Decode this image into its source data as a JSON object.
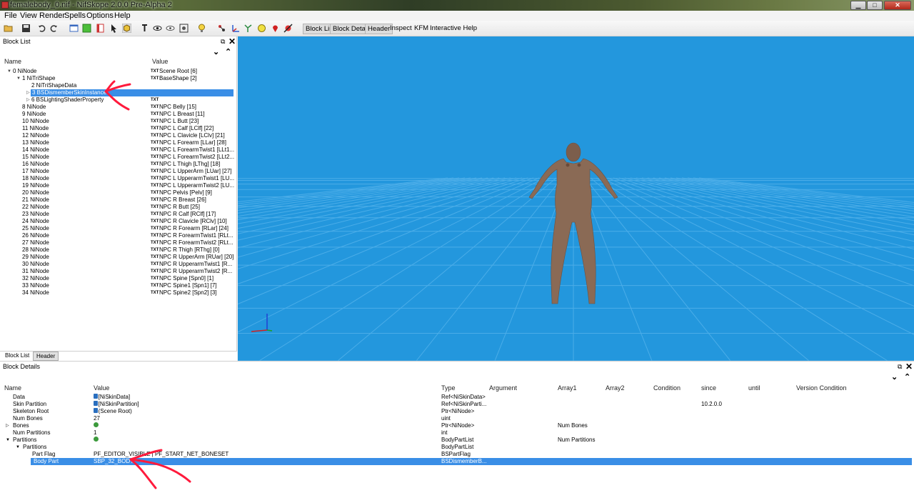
{
  "window": {
    "title": "femalebody_0.nif - NifSkope 2.0.0 Pre-Alpha 2",
    "minimize": "▁",
    "maximize": "□",
    "close": "✕"
  },
  "menu": [
    "File",
    "View",
    "Render",
    "Spells",
    "Options",
    "Help"
  ],
  "toolbar": {
    "buttons": [
      "Block List",
      "Block Details",
      "Header",
      "Inspect",
      "KFM",
      "Interactive Help"
    ]
  },
  "block_list": {
    "title": "Block List",
    "float_icon": "⧉",
    "close_icon": "✕",
    "expand_all": "⌄",
    "collapse_all": "⌃",
    "col_name": "Name",
    "col_value": "Value",
    "txt_icon": "TXT",
    "rows": [
      {
        "name": "0 NiNode",
        "value": "Scene Root [6]"
      },
      {
        "name": "1 NiTriShape",
        "value": "BaseShape [2]"
      },
      {
        "name": "2 NiTriShapeData",
        "value": ""
      },
      {
        "name": "3 BSDismemberSkinInstance",
        "value": ""
      },
      {
        "name": "6 BSLightingShaderProperty",
        "value": ""
      },
      {
        "name": "8 NiNode",
        "value": "NPC Belly [15]"
      },
      {
        "name": "9 NiNode",
        "value": "NPC L Breast [11]"
      },
      {
        "name": "10 NiNode",
        "value": "NPC L Butt [23]"
      },
      {
        "name": "11 NiNode",
        "value": "NPC L Calf [LClf] [22]"
      },
      {
        "name": "12 NiNode",
        "value": "NPC L Clavicle [LClv] [21]"
      },
      {
        "name": "13 NiNode",
        "value": "NPC L Forearm [LLar] [28]"
      },
      {
        "name": "14 NiNode",
        "value": "NPC L ForearmTwist1 [LLt1..."
      },
      {
        "name": "15 NiNode",
        "value": "NPC L ForearmTwist2 [LLt2..."
      },
      {
        "name": "16 NiNode",
        "value": "NPC L Thigh [LThg] [18]"
      },
      {
        "name": "17 NiNode",
        "value": "NPC L UpperArm [LUar] [27]"
      },
      {
        "name": "18 NiNode",
        "value": "NPC L UpperarmTwist1 [LU..."
      },
      {
        "name": "19 NiNode",
        "value": "NPC L UpperarmTwist2 [LU..."
      },
      {
        "name": "20 NiNode",
        "value": "NPC Pelvis [Pelv] [9]"
      },
      {
        "name": "21 NiNode",
        "value": "NPC R Breast [26]"
      },
      {
        "name": "22 NiNode",
        "value": "NPC R Butt [25]"
      },
      {
        "name": "23 NiNode",
        "value": "NPC R Calf [RClf] [17]"
      },
      {
        "name": "24 NiNode",
        "value": "NPC R Clavicle [RClv] [10]"
      },
      {
        "name": "25 NiNode",
        "value": "NPC R Forearm [RLar] [24]"
      },
      {
        "name": "26 NiNode",
        "value": "NPC R ForearmTwist1 [RLt..."
      },
      {
        "name": "27 NiNode",
        "value": "NPC R ForearmTwist2 [RLt..."
      },
      {
        "name": "28 NiNode",
        "value": "NPC R Thigh [RThg] [0]"
      },
      {
        "name": "29 NiNode",
        "value": "NPC R UpperArm [RUar] [20]"
      },
      {
        "name": "30 NiNode",
        "value": "NPC R UpperarmTwist1 [R..."
      },
      {
        "name": "31 NiNode",
        "value": "NPC R UpperarmTwist2 [R..."
      },
      {
        "name": "32 NiNode",
        "value": "NPC Spine [Spn0] [1]"
      },
      {
        "name": "33 NiNode",
        "value": "NPC Spine1 [Spn1] [7]"
      },
      {
        "name": "34 NiNode",
        "value": "NPC Spine2 [Spn2] [3]"
      }
    ],
    "tabs": [
      "Block List",
      "Header"
    ]
  },
  "block_details": {
    "title": "Block Details",
    "columns": [
      "Name",
      "Value",
      "Type",
      "Argument",
      "Array1",
      "Array2",
      "Condition",
      "since",
      "until",
      "Version Condition"
    ],
    "rows": [
      {
        "name": "Data",
        "value": "4 [NiSkinData]",
        "type": "Ref<NiSkinData>",
        "array1": "",
        "since": ""
      },
      {
        "name": "Skin Partition",
        "value": "5 [NiSkinPartition]",
        "type": "Ref<NiSkinParti...",
        "array1": "",
        "since": "10.2.0.0"
      },
      {
        "name": "Skeleton Root",
        "value": "0 (Scene Root)",
        "type": "Ptr<NiNode>",
        "array1": "",
        "since": ""
      },
      {
        "name": "Num Bones",
        "value": "27",
        "type": "uint",
        "array1": "",
        "since": ""
      },
      {
        "name": "Bones",
        "value": "",
        "type": "Ptr<NiNode>",
        "array1": "Num Bones",
        "since": ""
      },
      {
        "name": "Num Partitions",
        "value": "1",
        "type": "int",
        "array1": "",
        "since": ""
      },
      {
        "name": "Partitions",
        "value": "",
        "type": "BodyPartList",
        "array1": "Num Partitions",
        "since": ""
      },
      {
        "name": "Partitions",
        "value": "",
        "type": "BodyPartList",
        "array1": "",
        "since": ""
      },
      {
        "name": "Part Flag",
        "value": "PF_EDITOR_VISIBLE | PF_START_NET_BONESET",
        "type": "BSPartFlag",
        "array1": "",
        "since": ""
      },
      {
        "name": "Body Part",
        "value": "SBP_32_BODY",
        "type": "BSDismemberB...",
        "array1": "",
        "since": ""
      }
    ]
  },
  "colors": {
    "viewport_bg": "#2397dd",
    "selection": "#3a8ee6",
    "annotation": "#ff1a3c"
  }
}
